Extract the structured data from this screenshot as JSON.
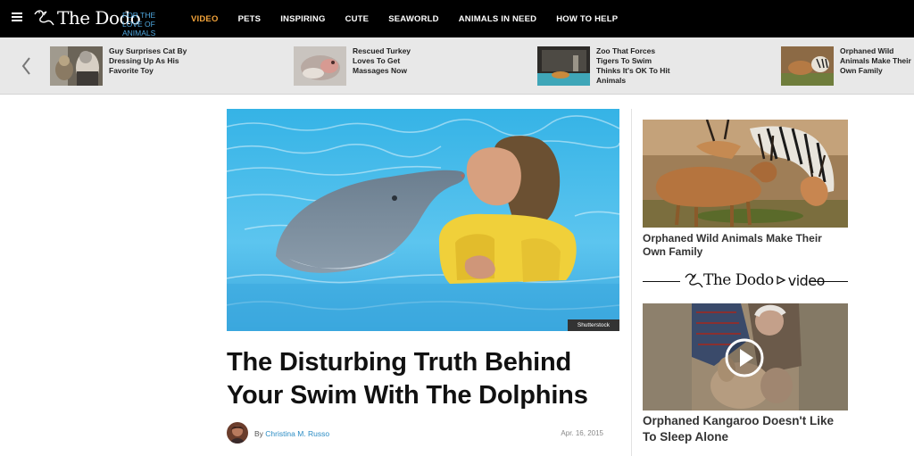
{
  "header": {
    "logo_text": "The Dodo",
    "tagline": "FOR THE LOVE OF ANIMALS",
    "nav": [
      "VIDEO",
      "PETS",
      "INSPIRING",
      "CUTE",
      "SEAWORLD",
      "ANIMALS IN NEED",
      "HOW TO HELP"
    ],
    "active_nav": "VIDEO"
  },
  "related": [
    {
      "title": "Guy Surprises Cat By Dressing Up As His Favorite Toy"
    },
    {
      "title": "Rescued Turkey Loves To Get Massages Now"
    },
    {
      "title": "Zoo That Forces Tigers To Swim Thinks It's OK To Hit Animals"
    },
    {
      "title": "Orphaned Wild Animals Make Their Own Family"
    }
  ],
  "article": {
    "image_credit": "Shutterstock",
    "headline": "The Disturbing Truth Behind Your Swim With The Dolphins",
    "by_prefix": "By",
    "author": "Christina M. Russo",
    "date": "Apr. 16, 2015"
  },
  "sidebar": {
    "story1_title": "Orphaned Wild Animals Make Their Own Family",
    "video_logo": "The Dodo",
    "video_word": "video",
    "story2_title": "Orphaned Kangaroo Doesn't Like To Sleep Alone"
  },
  "colors": {
    "nav_active": "#f2a33a",
    "tagline": "#4fa8e0",
    "link": "#2a8cc4"
  }
}
